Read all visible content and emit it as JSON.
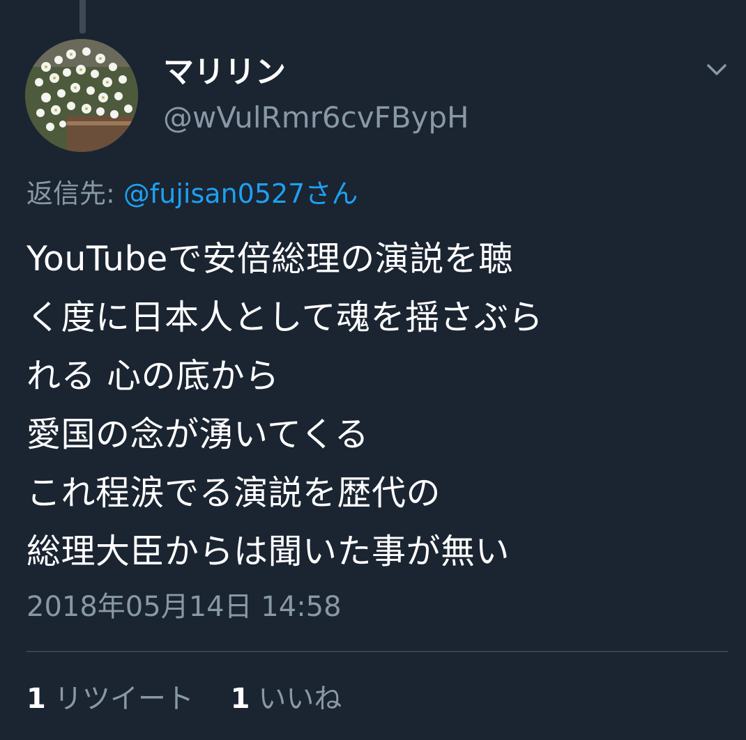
{
  "tweet": {
    "display_name": "マリリン",
    "handle": "@wVulRmr6cvFBypH",
    "reply_label": "返信先:",
    "reply_user": "@fujisan0527さん",
    "body_lines": [
      "YouTubeで安倍総理の演説を聴",
      "く度に日本人として魂を揺さぶら",
      "れる 心の底から",
      "愛国の念が湧いてくる",
      "これ程涙でる演説を歴代の",
      "総理大臣からは聞いた事が無い"
    ],
    "timestamp": "2018年05月14日 14:58",
    "retweets": {
      "count": "1",
      "label": "リツイート"
    },
    "likes": {
      "count": "1",
      "label": "いいね"
    }
  },
  "icons": {
    "menu": "chevron-down-icon",
    "avatar": "avatar-image"
  },
  "colors": {
    "background": "#1b2431",
    "text_primary": "#ffffff",
    "text_secondary": "#8899a6",
    "link": "#1da1f2",
    "divider": "#38444d"
  }
}
